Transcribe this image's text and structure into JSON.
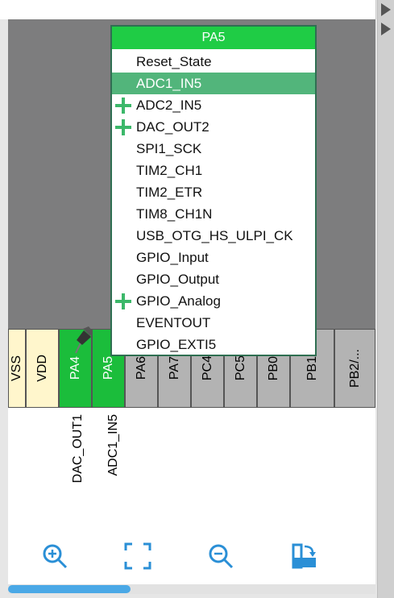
{
  "popup": {
    "title": "PA5",
    "items": [
      {
        "label": "Reset_State",
        "selected": false,
        "plus": false
      },
      {
        "label": "ADC1_IN5",
        "selected": true,
        "plus": false
      },
      {
        "label": "ADC2_IN5",
        "selected": false,
        "plus": true
      },
      {
        "label": "DAC_OUT2",
        "selected": false,
        "plus": true
      },
      {
        "label": "SPI1_SCK",
        "selected": false,
        "plus": false
      },
      {
        "label": "TIM2_CH1",
        "selected": false,
        "plus": false
      },
      {
        "label": "TIM2_ETR",
        "selected": false,
        "plus": false
      },
      {
        "label": "TIM8_CH1N",
        "selected": false,
        "plus": false
      },
      {
        "label": "USB_OTG_HS_ULPI_CK",
        "selected": false,
        "plus": false
      },
      {
        "label": "GPIO_Input",
        "selected": false,
        "plus": false
      },
      {
        "label": "GPIO_Output",
        "selected": false,
        "plus": false
      },
      {
        "label": "GPIO_Analog",
        "selected": false,
        "plus": true
      },
      {
        "label": "EVENTOUT",
        "selected": false,
        "plus": false
      },
      {
        "label": "GPIO_EXTI5",
        "selected": false,
        "plus": false
      }
    ]
  },
  "pins": [
    {
      "name": "VSS",
      "color": "yellow"
    },
    {
      "name": "VDD",
      "color": "yellow"
    },
    {
      "name": "PA4",
      "color": "green"
    },
    {
      "name": "PA5",
      "color": "green"
    },
    {
      "name": "PA6",
      "color": "gray"
    },
    {
      "name": "PA7",
      "color": "gray"
    },
    {
      "name": "PC4",
      "color": "gray"
    },
    {
      "name": "PC5",
      "color": "gray"
    },
    {
      "name": "PB0",
      "color": "gray"
    },
    {
      "name": "PB1",
      "color": "gray"
    },
    {
      "name": "PB2/...",
      "color": "gray"
    }
  ],
  "pin_labels": {
    "pa4": "DAC_OUT1",
    "pa5": "ADC1_IN5"
  },
  "toolbar": {
    "zoom_in": "zoom-in-icon",
    "fit": "fit-screen-icon",
    "zoom_out": "zoom-out-icon",
    "export": "export-icon"
  },
  "colors": {
    "pin_green": "#1bbd3b",
    "popup_header": "#1fcc45",
    "selected": "#52b57b",
    "chip_gray": "#7d7d7e",
    "scroll_thumb": "#4aa8e6"
  }
}
